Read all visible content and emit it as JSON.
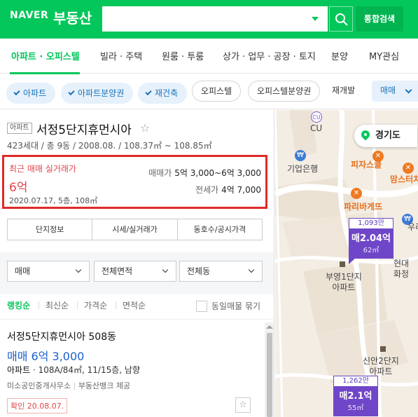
{
  "header": {
    "logo": "NAVER",
    "service": "부동산",
    "search_value": "",
    "search_button": "search-icon",
    "integrated_search": "통합검색",
    "brand_color": "#03c75a"
  },
  "nav": {
    "items": [
      {
        "label": "아파트 · 오피스텔",
        "active": true
      },
      {
        "label": "빌라 · 주택"
      },
      {
        "label": "원룸 · 투룸"
      },
      {
        "label": "상가 · 업무 · 공장 · 토지"
      },
      {
        "label": "분양"
      },
      {
        "label": "MY관심"
      }
    ]
  },
  "filters": {
    "chips": [
      {
        "label": "아파트",
        "selected": true
      },
      {
        "label": "아파트분양권",
        "selected": true
      },
      {
        "label": "재건축",
        "selected": true
      },
      {
        "label": "오피스텔",
        "selected": false
      },
      {
        "label": "오피스텔분양권",
        "selected": false
      },
      {
        "label": "재개발",
        "selected": false
      }
    ],
    "trade_type": "매매"
  },
  "complex": {
    "type": "아파트",
    "name": "서정5단지휴먼시아",
    "info": "423세대 / 총 9동 / 2008.08. / 108.37㎡ ~ 108.85㎡",
    "recent": {
      "label": "최근 매매 실거래가",
      "price": "6억",
      "detail": "2020.07.17, 5층, 108㎡"
    },
    "sale_label": "매매가",
    "sale_range": "5억 3,000~6억 3,000",
    "rent_label": "전세가",
    "rent_value": "4억 7,000",
    "tabs": [
      "단지정보",
      "시세/실거래가",
      "동호수/공시가격"
    ]
  },
  "selects": [
    "매매",
    "전체면적",
    "전체동"
  ],
  "sort": {
    "options": [
      "랭킹순",
      "최신순",
      "가격순",
      "면적순"
    ],
    "same_listing": "동일매물 묶기"
  },
  "listing": {
    "title": "서정5단지휴먼시아 508동",
    "price": "매매 6억 3,000",
    "type": "아파트",
    "spec": "108A/84㎡, 11/15층, 남향",
    "agent": "미소공인중개사무소",
    "agent_sep": "|",
    "provider": "부동산뱅크 제공",
    "confirm": "확인 20.08.07."
  },
  "map": {
    "region": "경기도",
    "labels": {
      "cu_icon": "CU",
      "cu": "CU",
      "bank": "기업은행",
      "pizza": "피자스쿨",
      "moms": "맘스터치",
      "paris": "파리바게뜨",
      "apt1": "부영1단지\n아파트",
      "apt2": "신안2단지\n아파트",
      "hyundai": "현대\n화정",
      "woori": "우리"
    },
    "markers": [
      {
        "count": "1,093만",
        "price": "매2.04억",
        "area": "62㎡"
      },
      {
        "count": "1,262만",
        "price": "매2.1억",
        "area": "55㎡"
      }
    ]
  }
}
